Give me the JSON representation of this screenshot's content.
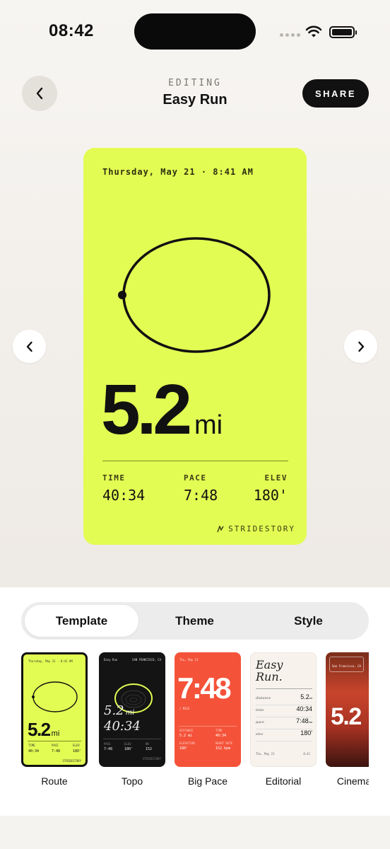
{
  "status_bar": {
    "time": "08:42"
  },
  "header": {
    "eyebrow": "EDITING",
    "title": "Easy Run",
    "share_label": "SHARE"
  },
  "card": {
    "date": "Thursday, May 21 · 8:41 AM",
    "distance": "5.2",
    "unit": "mi",
    "stats": [
      {
        "label": "TIME",
        "value": "40:34"
      },
      {
        "label": "PACE",
        "value": "7:48"
      },
      {
        "label": "ELEV",
        "value": "180'"
      }
    ],
    "brand": "STRIDESTORY",
    "background_color": "#e3fc53"
  },
  "tabs": [
    "Template",
    "Theme",
    "Style"
  ],
  "active_tab": "Template",
  "templates": [
    {
      "name": "Route",
      "selected": true,
      "date": "Thursday, May 21 · 8:41 AM",
      "distance": "5.2",
      "unit": "mi",
      "stats": [
        {
          "label": "TIME",
          "value": "40:34"
        },
        {
          "label": "PACE",
          "value": "7:48"
        },
        {
          "label": "ELEV",
          "value": "180'"
        }
      ],
      "brand": "STRIDESTORY"
    },
    {
      "name": "Topo",
      "selected": false,
      "header_left": "Easy Run",
      "header_right": "SAN FRANCISCO, CA",
      "distance": "5.2",
      "unit": "mi",
      "time": "40:34",
      "stats": [
        {
          "label": "PACE",
          "value": "7:48"
        },
        {
          "label": "ELEV",
          "value": "180'"
        },
        {
          "label": "HR",
          "value": "152"
        }
      ],
      "brand": "STRIDESTORY"
    },
    {
      "name": "Big Pace",
      "selected": false,
      "date": "Thu, May 21",
      "pace": "7:48",
      "pace_unit": "/ MILE",
      "stats": [
        {
          "label": "DISTANCE",
          "value": "5.2 mi"
        },
        {
          "label": "TIME",
          "value": "40:34"
        },
        {
          "label": "ELEVATION",
          "value": "180'"
        },
        {
          "label": "HEART RATE",
          "value": "152 bpm"
        }
      ]
    },
    {
      "name": "Editorial",
      "selected": false,
      "title_line1": "Easy",
      "title_line2": "Run.",
      "rows": [
        {
          "label": "distance",
          "value": "5.2",
          "unit": "mi"
        },
        {
          "label": "time",
          "value": "40:34"
        },
        {
          "label": "pace",
          "value": "7:48",
          "unit": "/mi"
        },
        {
          "label": "elev",
          "value": "180'"
        }
      ],
      "footer_left": "Thu, May 21",
      "footer_right": "8:41"
    },
    {
      "name": "Cinematic",
      "selected": false,
      "location": "San Francisco, CA",
      "distance": "5.2"
    }
  ]
}
